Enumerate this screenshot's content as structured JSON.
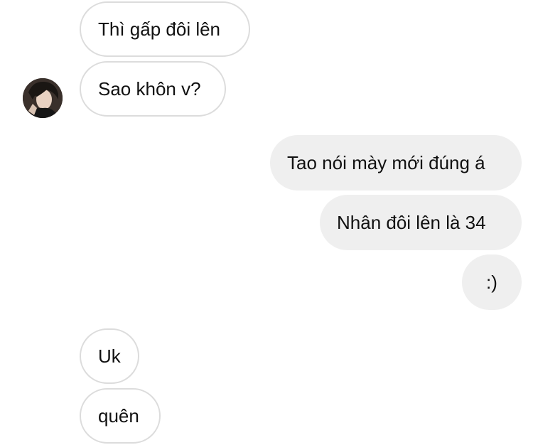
{
  "conversation": {
    "messages": [
      {
        "text": "Thì gấp đôi lên",
        "sender": "other"
      },
      {
        "text": "Sao khôn v?",
        "sender": "other"
      },
      {
        "text": "Tao nói mày mới đúng á",
        "sender": "me"
      },
      {
        "text": "Nhân đôi lên là 34",
        "sender": "me"
      },
      {
        "text": ":)",
        "sender": "me"
      },
      {
        "text": "Uk",
        "sender": "other"
      },
      {
        "text": "quên",
        "sender": "other"
      }
    ]
  },
  "colors": {
    "incoming_bubble_border": "#dcdcdc",
    "outgoing_bubble_bg": "#efefef",
    "text": "#111111"
  },
  "icons": {
    "avatar": "contact-avatar-photo"
  }
}
